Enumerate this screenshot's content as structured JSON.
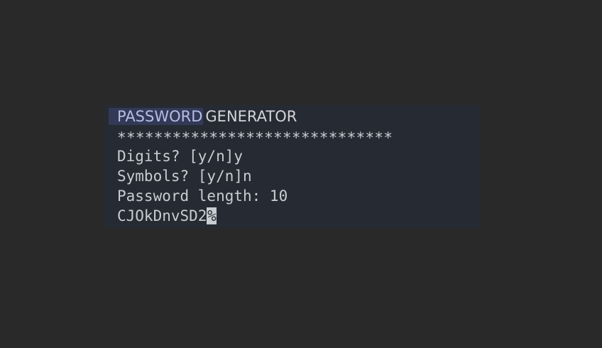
{
  "terminal": {
    "title_highlight": "PASSWORD",
    "title_rest": "GENERATOR",
    "stars": "******************************",
    "digits_prompt": "Digits? [y/n]y",
    "symbols_prompt": "Symbols? [y/n]n",
    "length_prompt": "Password length: 10",
    "password": "CJOkDnvSD2",
    "cursor_char": "%",
    "trailing_underscore": "_"
  },
  "colors": {
    "background": "#292929",
    "terminal_bg": "#262a33",
    "text": "#c9ccd1",
    "title_highlight_bg": "#333a57",
    "title_highlight_text": "#b6bde6"
  }
}
